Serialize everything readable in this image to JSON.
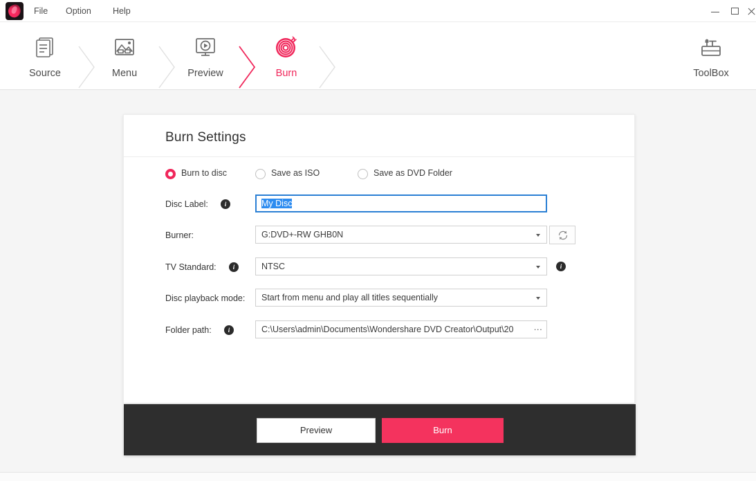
{
  "window": {
    "logo_icon": "app-flame-logo",
    "controls": {
      "minimize": "minimize-icon",
      "maximize": "maximize-icon",
      "close": "close-icon"
    }
  },
  "menubar": {
    "items": [
      {
        "label": "File"
      },
      {
        "label": "Option"
      },
      {
        "label": "Help"
      }
    ]
  },
  "steps": [
    {
      "label": "Source",
      "icon": "document-pages-icon",
      "active": false
    },
    {
      "label": "Menu",
      "icon": "image-gallery-icon",
      "active": false
    },
    {
      "label": "Preview",
      "icon": "monitor-play-icon",
      "active": false
    },
    {
      "label": "Burn",
      "icon": "burning-disc-icon",
      "active": true
    }
  ],
  "toolbox": {
    "label": "ToolBox",
    "icon": "toolbox-icon"
  },
  "card": {
    "title": "Burn Settings",
    "output_modes": [
      {
        "label": "Burn to disc",
        "selected": true
      },
      {
        "label": "Save as ISO",
        "selected": false
      },
      {
        "label": "Save as DVD Folder",
        "selected": false
      }
    ],
    "fields": {
      "disc_label": {
        "label": "Disc Label:",
        "info_icon": "info-icon",
        "value": "My Disc",
        "selected_text": "My Disc",
        "focused": true
      },
      "burner": {
        "label": "Burner:",
        "value": "G:DVD+-RW GHB0N",
        "caret_icon": "chevron-down-icon",
        "refresh_icon": "refresh-icon"
      },
      "tv_standard": {
        "label": "TV Standard:",
        "info_icon": "info-icon",
        "value": "NTSC",
        "caret_icon": "chevron-down-icon",
        "trailing_info_icon": "info-icon"
      },
      "playback_mode": {
        "label": "Disc playback mode:",
        "value": "Start from menu and play all titles sequentially",
        "caret_icon": "chevron-down-icon"
      },
      "folder_path": {
        "label": "Folder path:",
        "info_icon": "info-icon",
        "value": "C:\\Users\\admin\\Documents\\Wondershare DVD Creator\\Output\\20",
        "overflow_marker": "···"
      }
    },
    "footer": {
      "preview_label": "Preview",
      "burn_label": "Burn"
    }
  },
  "colors": {
    "accent": "#f0265a",
    "burn_button": "#f4335e",
    "footer_bar": "#2e2e2e",
    "page_background": "#f5f5f5",
    "selection_blue": "#2d8cf0",
    "focus_border": "#2a7fd4"
  }
}
